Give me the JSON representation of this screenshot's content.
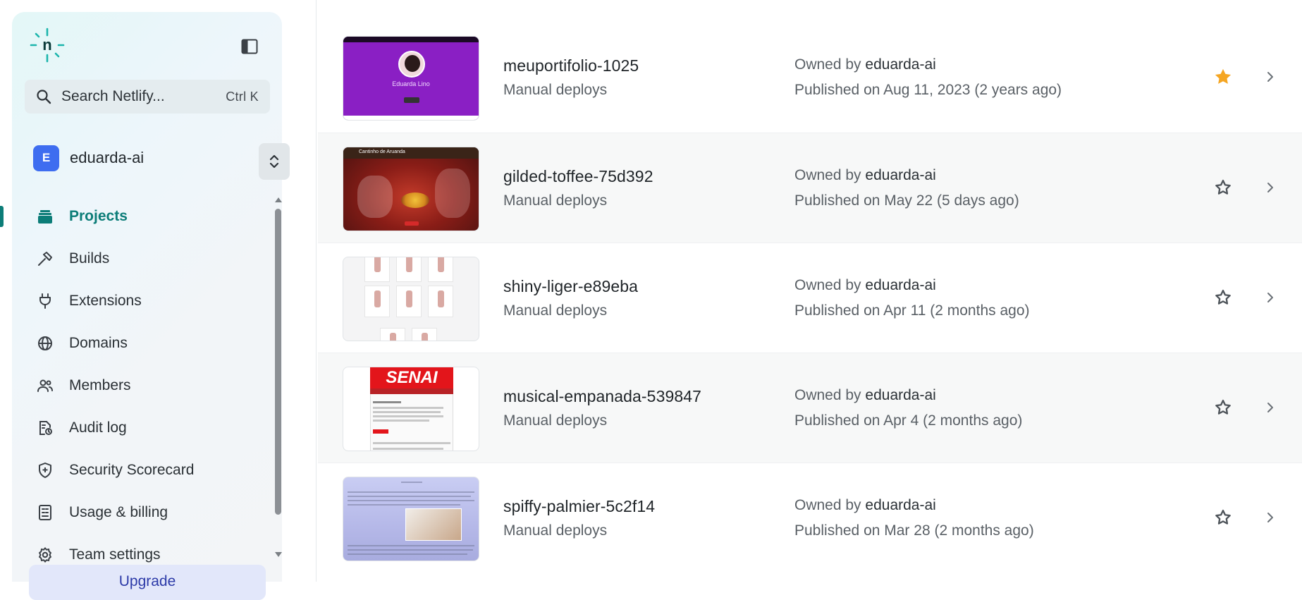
{
  "sidebar": {
    "search": {
      "label": "Search Netlify...",
      "shortcut": "Ctrl K"
    },
    "team": {
      "avatar_letter": "E",
      "name": "eduarda-ai"
    },
    "nav": [
      {
        "label": "Projects",
        "icon": "layers-icon",
        "active": true
      },
      {
        "label": "Builds",
        "icon": "hammer-icon",
        "active": false
      },
      {
        "label": "Extensions",
        "icon": "plug-icon",
        "active": false
      },
      {
        "label": "Domains",
        "icon": "globe-icon",
        "active": false
      },
      {
        "label": "Members",
        "icon": "users-icon",
        "active": false
      },
      {
        "label": "Audit log",
        "icon": "audit-log-icon",
        "active": false
      },
      {
        "label": "Security Scorecard",
        "icon": "shield-icon",
        "active": false
      },
      {
        "label": "Usage & billing",
        "icon": "billing-icon",
        "active": false
      },
      {
        "label": "Team settings",
        "icon": "gear-icon",
        "active": false
      }
    ],
    "upgrade_label": "Upgrade"
  },
  "projects": [
    {
      "name": "meuportifolio-1025",
      "deploy_type": "Manual deploys",
      "owner_prefix": "Owned by",
      "owner": "eduarda-ai",
      "published": "Published on Aug 11, 2023 (2 years ago)",
      "starred": true,
      "thumb_text": "Eduarda Lino"
    },
    {
      "name": "gilded-toffee-75d392",
      "deploy_type": "Manual deploys",
      "owner_prefix": "Owned by",
      "owner": "eduarda-ai",
      "published": "Published on May 22 (5 days ago)",
      "starred": false,
      "thumb_text": "Cantinho de Aruanda"
    },
    {
      "name": "shiny-liger-e89eba",
      "deploy_type": "Manual deploys",
      "owner_prefix": "Owned by",
      "owner": "eduarda-ai",
      "published": "Published on Apr 11 (2 months ago)",
      "starred": false,
      "thumb_text": ""
    },
    {
      "name": "musical-empanada-539847",
      "deploy_type": "Manual deploys",
      "owner_prefix": "Owned by",
      "owner": "eduarda-ai",
      "published": "Published on Apr 4 (2 months ago)",
      "starred": false,
      "thumb_text": "SENAI"
    },
    {
      "name": "spiffy-palmier-5c2f14",
      "deploy_type": "Manual deploys",
      "owner_prefix": "Owned by",
      "owner": "eduarda-ai",
      "published": "Published on Mar 28 (2 months ago)",
      "starred": false,
      "thumb_text": ""
    }
  ],
  "colors": {
    "accent": "#0c7d78",
    "star_filled": "#f5a623",
    "star_outline": "#5a6066",
    "avatar": "#3e6df0",
    "upgrade_bg": "#e2e7fa"
  }
}
